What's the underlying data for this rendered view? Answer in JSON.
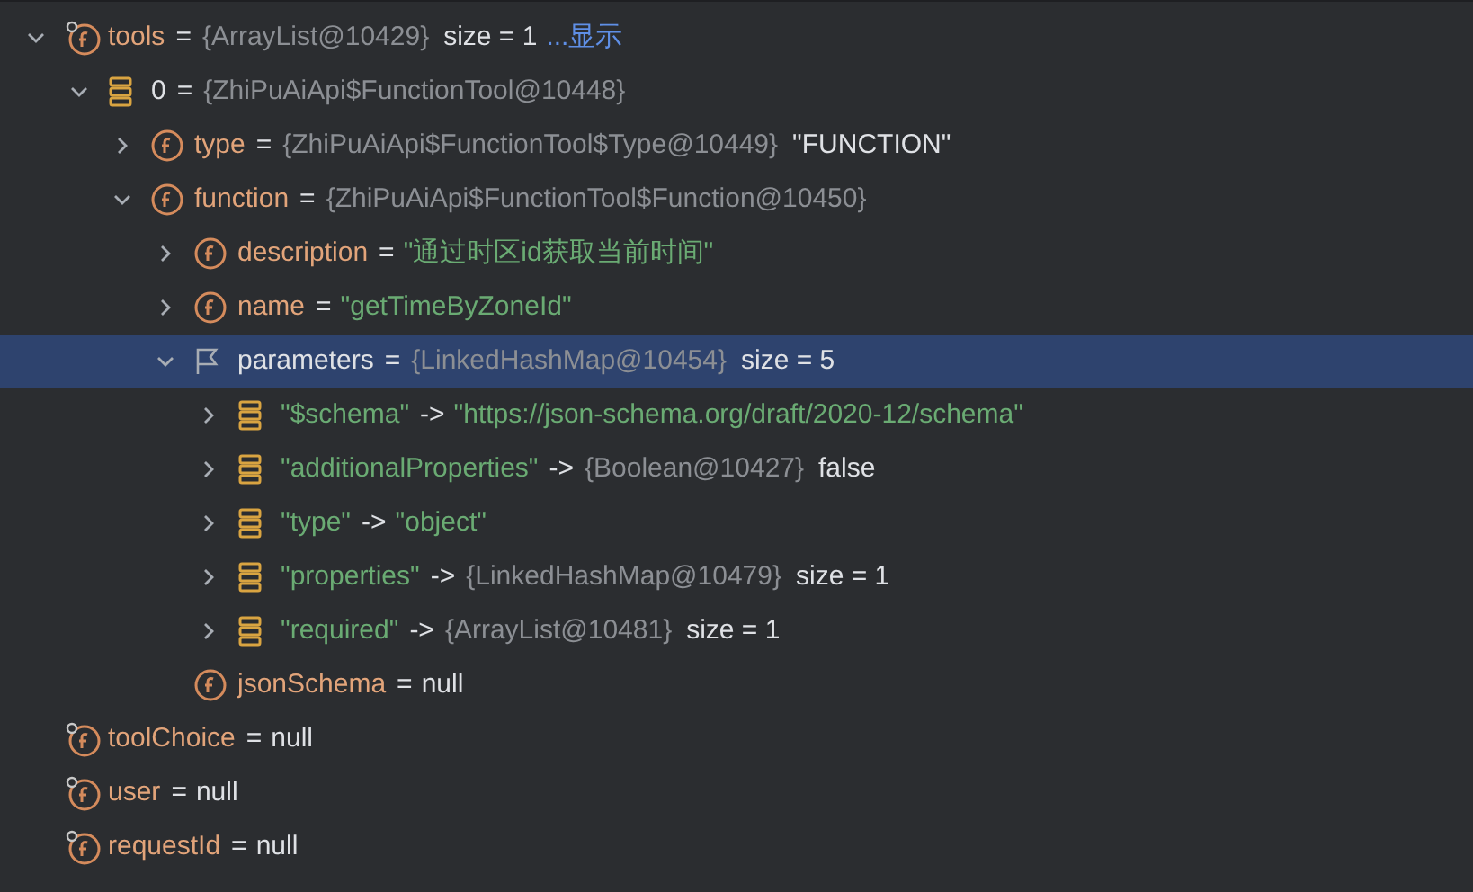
{
  "variables": [
    {
      "kind": "static",
      "name": "tools",
      "op": "=",
      "ref": "{ArrayList@10429}",
      "value": "size = 1",
      "link": "...显示",
      "expanded": true,
      "selected": false,
      "children": [
        {
          "kind": "element",
          "name": "0",
          "op": "=",
          "ref": "{ZhiPuAiApi$FunctionTool@10448}",
          "expanded": true,
          "selected": false,
          "children": [
            {
              "kind": "field",
              "name": "type",
              "op": "=",
              "ref": "{ZhiPuAiApi$FunctionTool$Type@10449}",
              "value": "\"FUNCTION\"",
              "expanded": false,
              "selected": false
            },
            {
              "kind": "field",
              "name": "function",
              "op": "=",
              "ref": "{ZhiPuAiApi$FunctionTool$Function@10450}",
              "expanded": true,
              "selected": false,
              "children": [
                {
                  "kind": "field",
                  "name": "description",
                  "op": "=",
                  "string_value": "\"通过时区id获取当前时间\"",
                  "expanded": false,
                  "selected": false
                },
                {
                  "kind": "field",
                  "name": "name",
                  "op": "=",
                  "string_value": "\"getTimeByZoneId\"",
                  "expanded": false,
                  "selected": false
                },
                {
                  "kind": "param",
                  "name": "parameters",
                  "op": "=",
                  "ref": "{LinkedHashMap@10454}",
                  "value": "size = 5",
                  "expanded": true,
                  "selected": true,
                  "children": [
                    {
                      "kind": "entry",
                      "name": "\"$schema\"",
                      "op": "->",
                      "string_value": "\"https://json-schema.org/draft/2020-12/schema\"",
                      "expanded": false,
                      "selected": false
                    },
                    {
                      "kind": "entry",
                      "name": "\"additionalProperties\"",
                      "op": "->",
                      "ref": "{Boolean@10427}",
                      "value": "false",
                      "expanded": false,
                      "selected": false
                    },
                    {
                      "kind": "entry",
                      "name": "\"type\"",
                      "op": "->",
                      "string_value": "\"object\"",
                      "expanded": false,
                      "selected": false
                    },
                    {
                      "kind": "entry",
                      "name": "\"properties\"",
                      "op": "->",
                      "ref": "{LinkedHashMap@10479}",
                      "value": "size = 1",
                      "expanded": false,
                      "selected": false
                    },
                    {
                      "kind": "entry",
                      "name": "\"required\"",
                      "op": "->",
                      "ref": "{ArrayList@10481}",
                      "value": "size = 1",
                      "expanded": false,
                      "selected": false
                    }
                  ]
                },
                {
                  "kind": "field",
                  "name": "jsonSchema",
                  "op": "=",
                  "value": "null",
                  "selected": false
                }
              ]
            }
          ]
        }
      ]
    },
    {
      "kind": "static",
      "name": "toolChoice",
      "op": "=",
      "value": "null",
      "selected": false
    },
    {
      "kind": "static",
      "name": "user",
      "op": "=",
      "value": "null",
      "selected": false
    },
    {
      "kind": "static",
      "name": "requestId",
      "op": "=",
      "value": "null",
      "selected": false
    }
  ]
}
